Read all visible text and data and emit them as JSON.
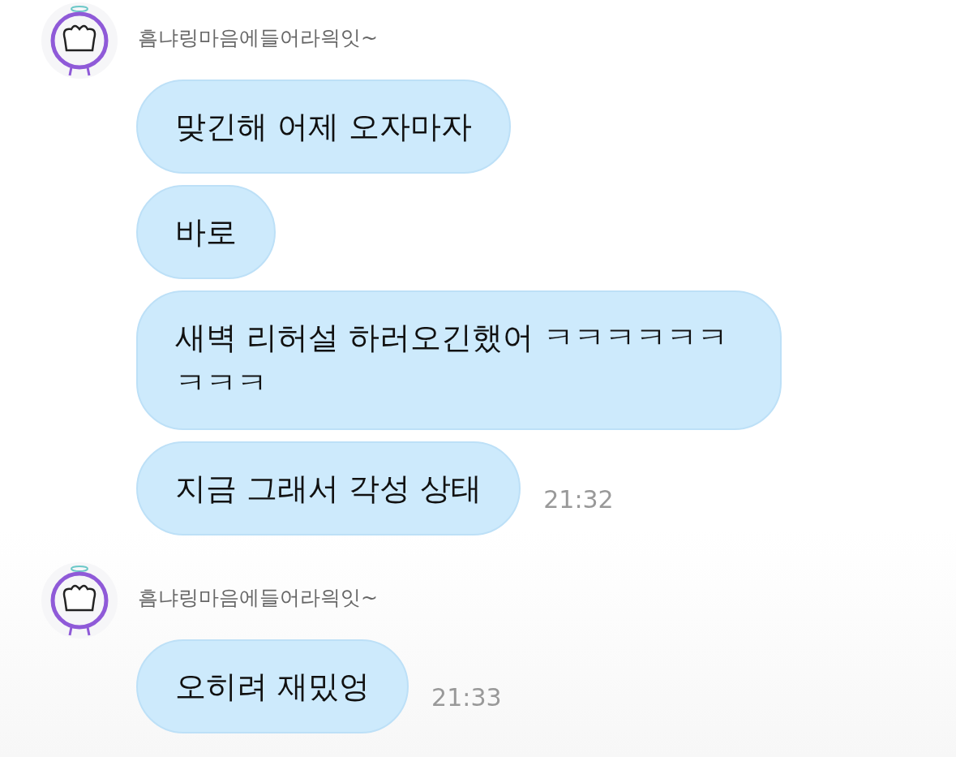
{
  "groups": [
    {
      "sender": "흠냐링마음에들어라읙잇~",
      "messages": [
        {
          "text": "맞긴해 어제 오자마자"
        },
        {
          "text": "바로"
        },
        {
          "text": "새벽 리허설 하러오긴했어 ㅋㅋㅋㅋㅋㅋㅋㅋㅋ"
        },
        {
          "text": "지금 그래서 각성 상태"
        }
      ],
      "time": "21:32"
    },
    {
      "sender": "흠냐링마음에들어라읙잇~",
      "messages": [
        {
          "text": "오히려 재밌엉"
        }
      ],
      "time": "21:33"
    }
  ]
}
